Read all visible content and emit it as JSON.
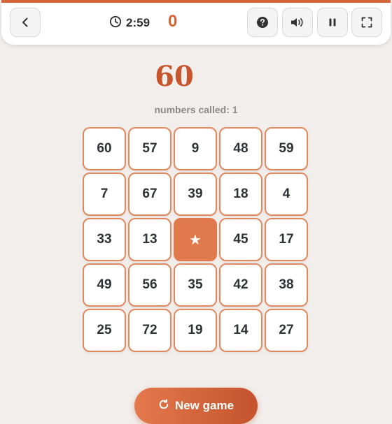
{
  "header": {
    "timer": "2:59",
    "score": "0"
  },
  "game": {
    "called_number": "60",
    "numbers_called_label": "numbers called: 1"
  },
  "board": {
    "cells": [
      [
        "60",
        "57",
        "9",
        "48",
        "59"
      ],
      [
        "7",
        "67",
        "39",
        "18",
        "4"
      ],
      [
        "33",
        "13",
        "★",
        "45",
        "17"
      ],
      [
        "49",
        "56",
        "35",
        "42",
        "38"
      ],
      [
        "25",
        "72",
        "19",
        "14",
        "27"
      ]
    ],
    "free_cell": [
      2,
      2
    ]
  },
  "actions": {
    "new_game_label": "New game"
  },
  "icons": {
    "back": "chevron-left-icon",
    "timer": "clock-icon",
    "help": "help-icon",
    "sound": "speaker-icon",
    "pause": "pause-icon",
    "fullscreen": "fullscreen-icon",
    "new_game": "refresh-icon"
  },
  "colors": {
    "accent": "#d4663a",
    "called_number": "#c9552d",
    "free_cell": "#e07a4c",
    "cell_border": "#e0895f",
    "background": "#f1eeeb"
  }
}
